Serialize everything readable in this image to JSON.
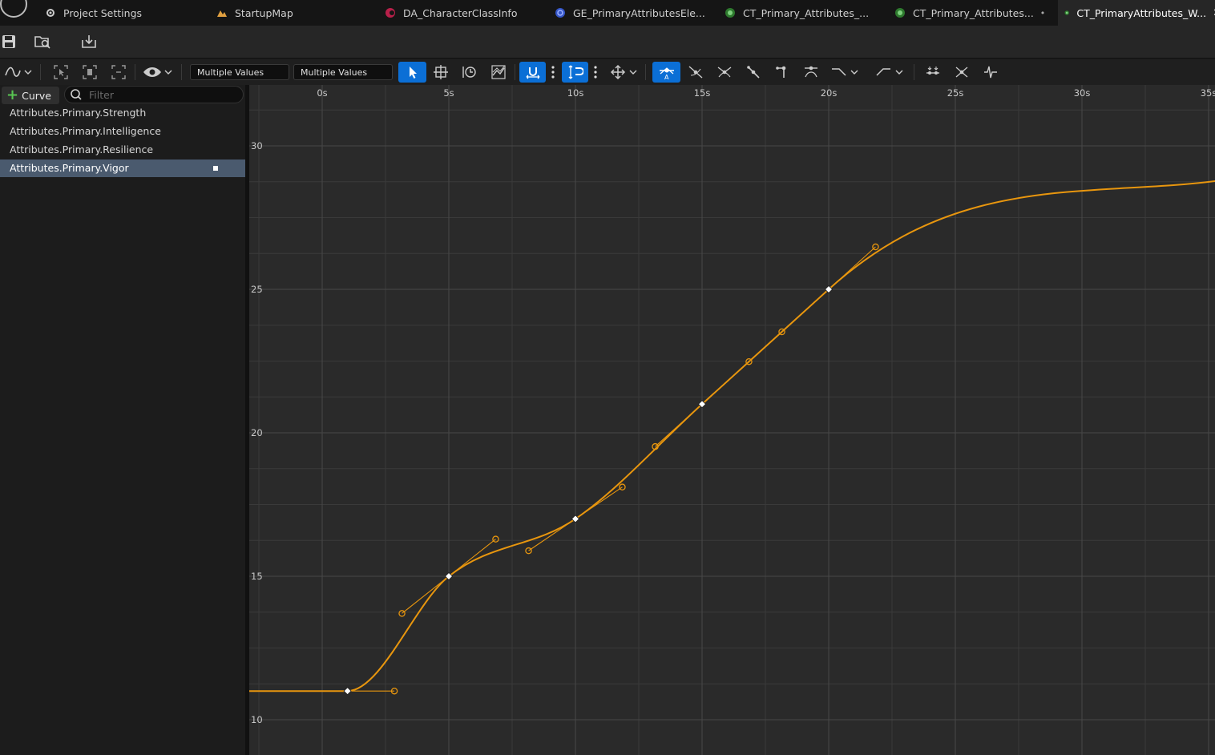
{
  "tabs": [
    {
      "label": "Project Settings",
      "icon": "gear-icon"
    },
    {
      "label": "StartupMap",
      "icon": "level-icon"
    },
    {
      "label": "DA_CharacterClassInfo",
      "icon": "data-asset-icon"
    },
    {
      "label": "GE_PrimaryAttributesEle...",
      "icon": "gameplay-effect-icon"
    },
    {
      "label": "CT_Primary_Attributes_...",
      "icon": "curve-table-icon"
    },
    {
      "label": "CT_Primary_Attributes...",
      "icon": "curve-table-icon",
      "dirty": "•"
    },
    {
      "label": "CT_PrimaryAttributes_W...",
      "icon": "curve-table-icon",
      "close": "✕"
    }
  ],
  "toolbar2": {
    "time_value": "Multiple Values",
    "value_value": "Multiple Values"
  },
  "curve_panel": {
    "add_label": "Curve",
    "filter_placeholder": "Filter",
    "items": [
      {
        "label": "Attributes.Primary.Strength"
      },
      {
        "label": "Attributes.Primary.Intelligence"
      },
      {
        "label": "Attributes.Primary.Resilience"
      },
      {
        "label": "Attributes.Primary.Vigor",
        "selected": true
      }
    ]
  },
  "graph": {
    "time_labels": [
      "0s",
      "5s",
      "10s",
      "15s",
      "20s",
      "25s",
      "30s",
      "35s"
    ],
    "value_labels": [
      "30",
      "25",
      "20",
      "15",
      "10"
    ],
    "curve_color": "#e8960e",
    "keys": [
      {
        "t": 1,
        "v": 11
      },
      {
        "t": 5,
        "v": 15
      },
      {
        "t": 10,
        "v": 17
      },
      {
        "t": 15,
        "v": 21
      },
      {
        "t": 20,
        "v": 25
      }
    ]
  },
  "colors": {
    "accent": "#0b6fd6",
    "selection": "#4a5a6e",
    "background": "#2a2a2a"
  }
}
